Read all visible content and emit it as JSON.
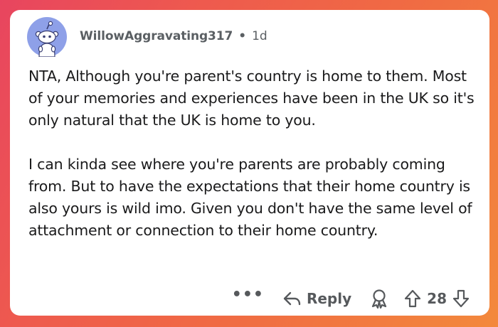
{
  "comment": {
    "username": "WillowAggravating317",
    "separator": "•",
    "age": "1d",
    "paragraphs": [
      "NTA, Although you're parent's country is home to them. Most of your memories and experiences have been in the UK so it's only natural that the UK is home to you.",
      "I can kinda see where you're parents are probably coming from. But to have the expectations that their home country is also yours is wild imo. Given you don't have the same level of attachment or connection to their home country."
    ]
  },
  "actions": {
    "more_label": "•••",
    "reply_label": "Reply",
    "score": "28"
  },
  "icons": {
    "avatar": "snoo-avatar-icon",
    "reply": "reply-arrow-icon",
    "award": "award-icon",
    "upvote": "upvote-arrow-icon",
    "downvote": "downvote-arrow-icon"
  },
  "colors": {
    "background_gradient_start": "#e8455f",
    "background_gradient_end": "#f3893c",
    "avatar_bg": "#8ea0e8",
    "text": "#1a1a1b",
    "meta_text": "#5a5f63"
  }
}
